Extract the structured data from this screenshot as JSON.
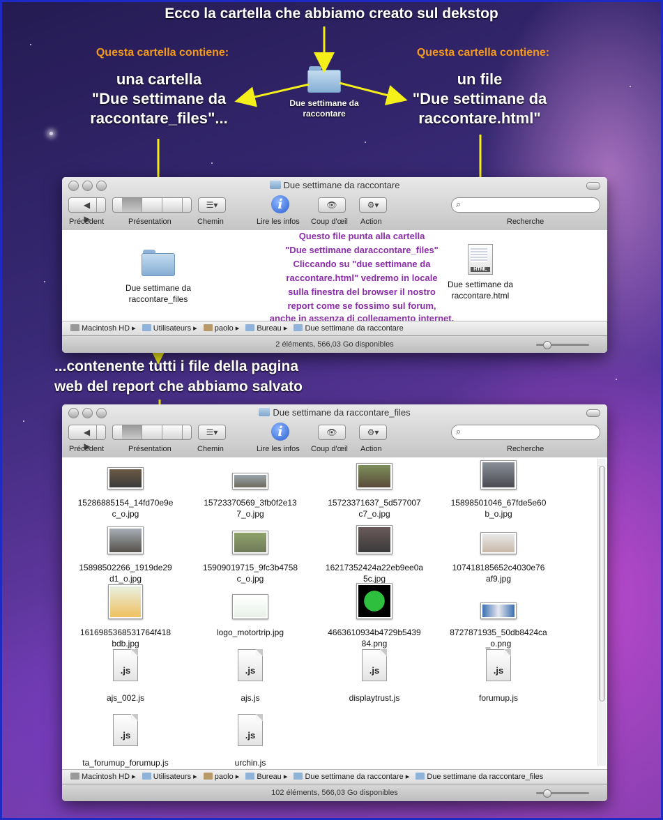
{
  "annotations": {
    "top_title": "Ecco la cartella che abbiamo creato sul dekstop",
    "left_contains": "Questa cartella contiene:",
    "right_contains": "Questa cartella contiene:",
    "left_desc_1": "una cartella",
    "left_desc_2": "\"Due settimane da",
    "left_desc_3": "raccontare_files\"...",
    "right_desc_1": "un file",
    "right_desc_2": "\"Due settimane da",
    "right_desc_3": "raccontare.html\"",
    "desktop_folder_1": "Due settimane da",
    "desktop_folder_2": "raccontare",
    "purple_lines": [
      "Questo file punta alla cartella",
      "\"Due settimane daraccontare_files\"",
      "Cliccando su \"due settimane da",
      "raccontare.html\" vedremo in locale",
      "sulla finestra del browser il nostro",
      "report come se fossimo sul forum,",
      "anche in assenza di collegamento internet."
    ],
    "middle_line_1": "...contenente tutti i file della pagina",
    "middle_line_2": "web del report che abbiamo salvato"
  },
  "toolbar": {
    "back": "Précédent",
    "view": "Présentation",
    "path": "Chemin",
    "info": "Lire les infos",
    "quicklook": "Coup d'œil",
    "action": "Action",
    "search": "Recherche",
    "info_glyph": "i",
    "back_glyph": "◀",
    "forward_glyph": "▶",
    "eye_glyph": "👁",
    "gear_glyph": "⚙▾",
    "path_glyph": "☰▾"
  },
  "window1": {
    "title": "Due settimane da raccontare",
    "folder_item_1": "Due settimane da",
    "folder_item_2": "raccontare_files",
    "html_item_1": "Due settimane da",
    "html_item_2": "raccontare.html",
    "html_badge": "HTML",
    "path": [
      "Macintosh HD",
      "Utilisateurs",
      "paolo",
      "Bureau",
      "Due settimane da raccontare"
    ],
    "status": "2 éléments, 566,03 Go disponibles"
  },
  "window2": {
    "title": "Due settimane da raccontare_files",
    "files": [
      [
        "15286885154_14fd70e9e",
        "c_o.jpg"
      ],
      [
        "15723370569_3fb0f2e13",
        "7_o.jpg"
      ],
      [
        "15723371637_5d577007",
        "c7_o.jpg"
      ],
      [
        "15898501046_67fde5e60",
        "b_o.jpg"
      ],
      [
        "15898502266_1919de29",
        "d1_o.jpg"
      ],
      [
        "15909019715_9fc3b4758",
        "c_o.jpg"
      ],
      [
        "16217352424a22eb9ee0a",
        "5c.jpg"
      ],
      [
        "107418185652c4030e76",
        "af9.jpg"
      ],
      [
        "1616985368531764f418",
        "bdb.jpg"
      ],
      [
        "logo_motortrip.jpg",
        ""
      ],
      [
        "4663610934b4729b5439",
        "84.png"
      ],
      [
        "8727871935_50db8424ca",
        "_o.png"
      ],
      [
        "ajs_002.js",
        ""
      ],
      [
        "ajs.js",
        ""
      ],
      [
        "displaytrust.js",
        ""
      ],
      [
        "forumup.js",
        ""
      ],
      [
        "ta_forumup_forumup.js",
        ""
      ],
      [
        "urchin.js",
        ""
      ]
    ],
    "js_glyph": ".js",
    "path": [
      "Macintosh HD",
      "Utilisateurs",
      "paolo",
      "Bureau",
      "Due settimane da raccontare",
      "Due settimane da raccontare_files"
    ],
    "status": "102 éléments, 566,03 Go disponibles"
  },
  "colors": {
    "arrow": "#f5f01a",
    "orange_text": "#f49a1c",
    "purple_text": "#8b2da8",
    "frame_border": "#1d2bc4"
  }
}
